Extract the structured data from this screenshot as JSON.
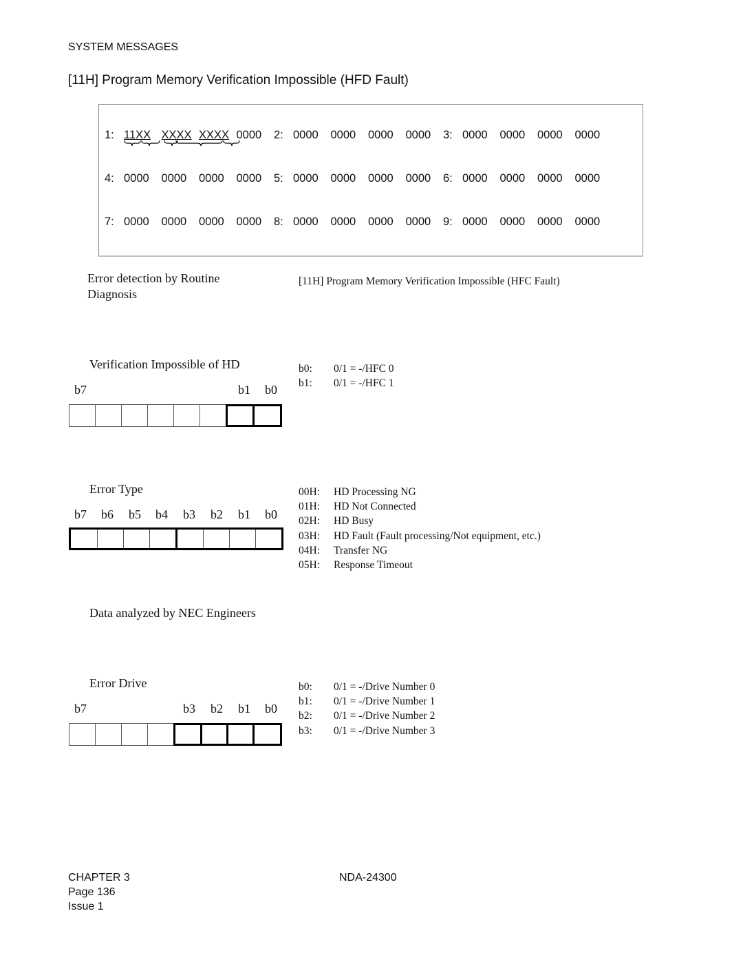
{
  "header": {
    "section": "SYSTEM MESSAGES",
    "title": "[11H] Program Memory Verification Impossible (HFD Fault)"
  },
  "dump": {
    "rows": [
      {
        "entries": [
          {
            "label": "1:",
            "groups": [
              "11XX",
              "XXXX",
              "XXXX",
              "0000"
            ]
          },
          {
            "label": "2:",
            "groups": [
              "0000",
              "0000",
              "0000",
              "0000"
            ]
          },
          {
            "label": "3:",
            "groups": [
              "0000",
              "0000",
              "0000",
              "0000"
            ]
          }
        ]
      },
      {
        "entries": [
          {
            "label": "4:",
            "groups": [
              "0000",
              "0000",
              "0000",
              "0000"
            ]
          },
          {
            "label": "5:",
            "groups": [
              "0000",
              "0000",
              "0000",
              "0000"
            ]
          },
          {
            "label": "6:",
            "groups": [
              "0000",
              "0000",
              "0000",
              "0000"
            ]
          }
        ]
      },
      {
        "entries": [
          {
            "label": "7:",
            "groups": [
              "0000",
              "0000",
              "0000",
              "0000"
            ]
          },
          {
            "label": "8:",
            "groups": [
              "0000",
              "0000",
              "0000",
              "0000"
            ]
          },
          {
            "label": "9:",
            "groups": [
              "0000",
              "0000",
              "0000",
              "0000"
            ]
          }
        ]
      }
    ]
  },
  "detection": {
    "label_line1": "Error detection by Routine",
    "label_line2": "Diagnosis",
    "description": "[11H] Program Memory Verification Impossible (HFC Fault)"
  },
  "verification": {
    "title": "Verification Impossible of HD",
    "bit_labels": {
      "left": "b7",
      "b1": "b1",
      "b0": "b0"
    },
    "defs": [
      {
        "key": "b0:",
        "value": "0/1 = -/HFC 0"
      },
      {
        "key": "b1:",
        "value": "0/1 = -/HFC 1"
      }
    ]
  },
  "error_type": {
    "title": "Error Type",
    "bit_labels": [
      "b7",
      "b6",
      "b5",
      "b4",
      "b3",
      "b2",
      "b1",
      "b0"
    ],
    "defs": [
      {
        "key": "00H:",
        "value": "HD Processing NG"
      },
      {
        "key": "01H:",
        "value": "HD Not Connected"
      },
      {
        "key": "02H:",
        "value": "HD Busy"
      },
      {
        "key": "03H:",
        "value": "HD Fault (Fault processing/Not equipment, etc.)"
      },
      {
        "key": "04H:",
        "value": "Transfer NG"
      },
      {
        "key": "05H:",
        "value": "Response Timeout"
      }
    ]
  },
  "nec_note": "Data analyzed by NEC Engineers",
  "error_drive": {
    "title": "Error Drive",
    "bit_labels": {
      "left": "b7",
      "b3": "b3",
      "b2": "b2",
      "b1": "b1",
      "b0": "b0"
    },
    "defs": [
      {
        "key": "b0:",
        "value": "0/1 = -/Drive Number 0"
      },
      {
        "key": "b1:",
        "value": "0/1 = -/Drive Number 1"
      },
      {
        "key": "b2:",
        "value": "0/1 = -/Drive Number 2"
      },
      {
        "key": "b3:",
        "value": "0/1 = -/Drive Number 3"
      }
    ]
  },
  "footer": {
    "chapter": "CHAPTER 3",
    "page": "Page 136",
    "issue": "Issue 1",
    "doc_number": "NDA-24300"
  }
}
